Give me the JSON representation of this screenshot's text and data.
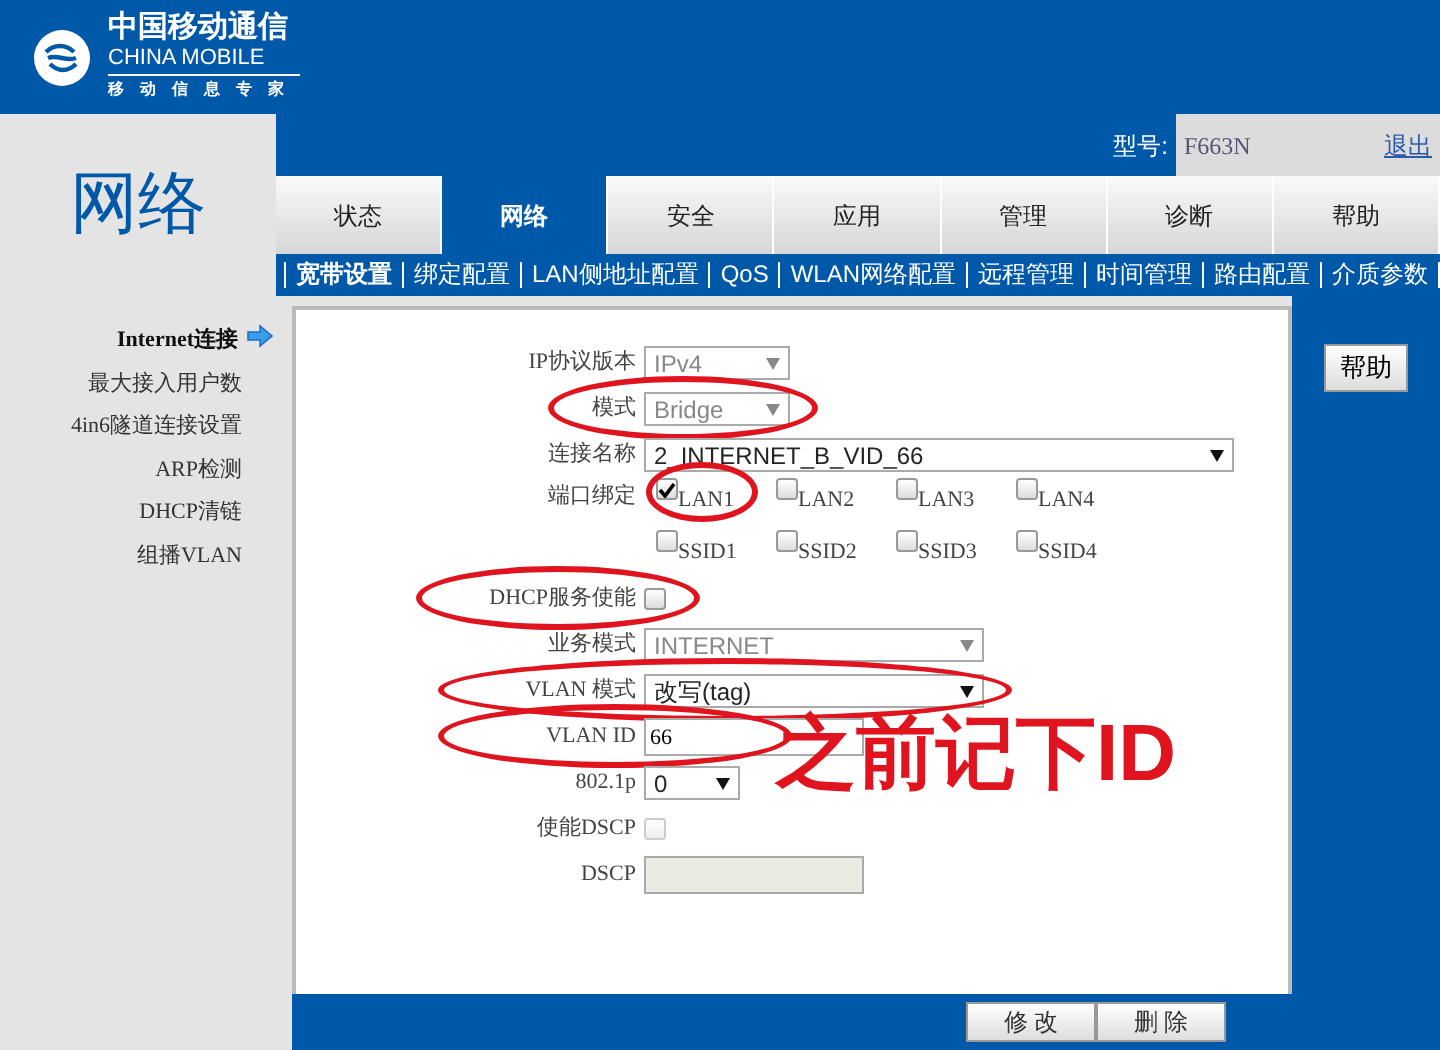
{
  "logo": {
    "title": "中国移动通信",
    "subtitle": "CHINA MOBILE",
    "slogan": "移动信息专家"
  },
  "page_title": "网络",
  "model": {
    "label": "型号:",
    "value": "F663N"
  },
  "logout": "退出",
  "tabs": [
    {
      "label": "状态",
      "selected": false
    },
    {
      "label": "网络",
      "selected": true
    },
    {
      "label": "安全",
      "selected": false
    },
    {
      "label": "应用",
      "selected": false
    },
    {
      "label": "管理",
      "selected": false
    },
    {
      "label": "诊断",
      "selected": false
    },
    {
      "label": "帮助",
      "selected": false
    }
  ],
  "subnav": [
    {
      "label": "宽带设置",
      "selected": true
    },
    {
      "label": "绑定配置",
      "selected": false
    },
    {
      "label": "LAN侧地址配置",
      "selected": false
    },
    {
      "label": "QoS",
      "selected": false
    },
    {
      "label": "WLAN网络配置",
      "selected": false
    },
    {
      "label": "远程管理",
      "selected": false
    },
    {
      "label": "时间管理",
      "selected": false
    },
    {
      "label": "路由配置",
      "selected": false
    },
    {
      "label": "介质参数",
      "selected": false
    }
  ],
  "sidebar": {
    "items": [
      {
        "label": "Internet连接",
        "selected": true
      },
      {
        "label": "最大接入用户数",
        "selected": false
      },
      {
        "label": "4in6隧道连接设置",
        "selected": false
      },
      {
        "label": "ARP检测",
        "selected": false
      },
      {
        "label": "DHCP清链",
        "selected": false
      },
      {
        "label": "组播VLAN",
        "selected": false
      }
    ]
  },
  "form": [
    {
      "kind": "short-select",
      "label": "IP协议版本",
      "value": "IPv4",
      "disabled": true,
      "circled": false
    },
    {
      "kind": "short-select",
      "label": "模式",
      "value": "Bridge",
      "disabled": true,
      "circled": true
    },
    {
      "kind": "long-select",
      "label": "连接名称",
      "value": "2_INTERNET_B_VID_66",
      "disabled": false,
      "circled": false
    },
    {
      "kind": "checkboxes",
      "label": "端口绑定",
      "options": [
        {
          "label": "LAN1",
          "checked": true,
          "circled": true
        },
        {
          "label": "LAN2",
          "checked": false,
          "circled": false
        },
        {
          "label": "LAN3",
          "checked": false,
          "circled": false
        },
        {
          "label": "LAN4",
          "checked": false,
          "circled": false
        },
        {
          "label": "SSID1",
          "checked": false,
          "circled": false
        },
        {
          "label": "SSID2",
          "checked": false,
          "circled": false
        },
        {
          "label": "SSID3",
          "checked": false,
          "circled": false
        },
        {
          "label": "SSID4",
          "checked": false,
          "circled": false
        }
      ]
    },
    {
      "kind": "checkbox",
      "label": "DHCP服务使能",
      "checked": false,
      "disabled": false,
      "circled": true
    },
    {
      "kind": "medium-select",
      "label": "业务模式",
      "value": "INTERNET",
      "disabled": true,
      "circled": false
    },
    {
      "kind": "medium-select",
      "label": "VLAN 模式",
      "value": "改写(tag)",
      "disabled": false,
      "circled": true
    },
    {
      "kind": "text",
      "label": "VLAN ID",
      "value": "66",
      "disabled": false,
      "circled": true
    },
    {
      "kind": "tiny-select",
      "label": "802.1p",
      "value": "0",
      "disabled": false,
      "circled": false
    },
    {
      "kind": "checkbox",
      "label": "使能DSCP",
      "checked": false,
      "disabled": true,
      "circled": false
    },
    {
      "kind": "text",
      "label": "DSCP",
      "disabled": true,
      "circled": false
    }
  ],
  "handwritten_note": "之前记下ID",
  "help_button": "帮助",
  "buttons": [
    "修 改",
    "删 除"
  ]
}
